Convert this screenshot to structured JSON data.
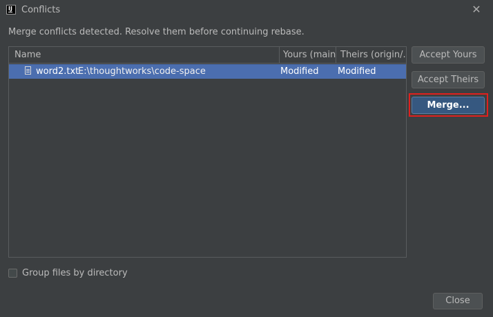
{
  "window": {
    "title": "Conflicts",
    "app_icon": "intellij-icon",
    "close_icon": "close-icon"
  },
  "message": "Merge conflicts detected. Resolve them before continuing rebase.",
  "table": {
    "columns": [
      "Name",
      "Yours (main)",
      "Theirs (origin/..."
    ],
    "rows": [
      {
        "file": "word2.txt",
        "path": "E:\\thoughtworks\\code-space",
        "yours": "Modified",
        "theirs": "Modified",
        "icon": "text-file-icon",
        "selected": true
      }
    ]
  },
  "actions": {
    "accept_yours": "Accept Yours",
    "accept_theirs": "Accept Theirs",
    "merge": "Merge..."
  },
  "options": {
    "group_by_directory_label": "Group files by directory",
    "group_by_directory_checked": false
  },
  "footer": {
    "close_label": "Close"
  },
  "colors": {
    "background": "#3c3f41",
    "selection": "#4b6eaf",
    "default_button": "#365880",
    "highlight": "#e0201e"
  }
}
